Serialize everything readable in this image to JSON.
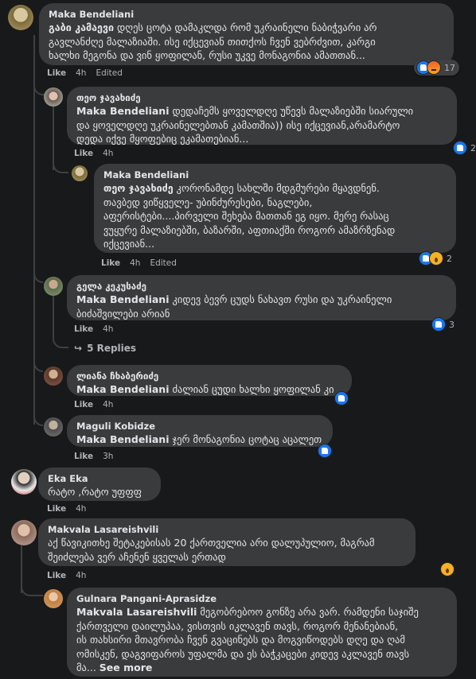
{
  "comments": [
    {
      "name": "Maka Bendeliani",
      "mention": "გაბი კამაევი",
      "text": " დღეს ცოტა დამაკლდა რომ უკრაინელი ნაბიჭვარი არ\nგავლანძღე მალაზიაში. ისე იქცევიან თითქოს ჩვენ ვებრძვით, კარგი\nხალხი მეგონა და ვინ ყოფილან, რუსი უკვე მონაგონია ამათთან...",
      "like": "Like",
      "time": "4h",
      "edited": "Edited",
      "count": "17"
    },
    {
      "name": "თეო ჯავახიძე",
      "mention": "Maka Bendeliani",
      "text": " დედაჩემს ყოველდღე უწევს მალაზიებში სიარული\nდა ყოველდღე უკრაინელებთან კამათშია)) ისე იქცევიან,არამარტო\nდედა იქვე მყოფებიც ეკამათებიან...",
      "like": "Like",
      "time": "4h",
      "count": "2"
    },
    {
      "name": "Maka Bendeliani",
      "mention": "თეო ჯავახიძე",
      "text": " კორონამდე სახლში მდგმურები მყავდნენ.\nთავბედ ვიწყველე- უბინძურესები, ნაგლები,\nაფერისტები....პირველი შეხება მათთან ეგ იყო. მერე რასაც\nვუყურე მალაზიებში, ბაზარში, აფთიაქში როგორ ამაზრზენად\nიქცევიან...",
      "like": "Like",
      "time": "4h",
      "edited": "Edited",
      "count": "2"
    },
    {
      "name": "გელა კეკუსაძე",
      "mention": "Maka Bendeliani",
      "text": " კიდევ ბევრ ცუდს ნახავთ რუსი და უკრაინელი\nბიძაშვილები არიან",
      "like": "Like",
      "time": "4h",
      "count": "3"
    },
    {
      "name": "ლიანა ჩხაბერიძე",
      "mention": "Maka Bendeliani",
      "text": " ძალიან ცუდი ხალხი ყოფილან კი",
      "like": "Like",
      "time": "4h"
    },
    {
      "name": "Maguli Kobidze",
      "mention": "Maka Bendeliani",
      "text": " ჯერ მონაგონია ცოტაც აცალეთ",
      "like": "Like",
      "time": "3h"
    },
    {
      "name": "Eka Eka",
      "mention": "",
      "text": "რატო ,რატო უფფფ",
      "like": "Like",
      "time": "4h"
    },
    {
      "name": "Makvala Lasareishvili",
      "mention": "",
      "text": "აქ წავიკითხე შეტაკებისას 20 ქართველია არი დალუპულიო, მაგრამ\nშეიძლება ვერ აჩენენ ყველას ერთად",
      "like": "Like",
      "time": "4h"
    },
    {
      "name": "Gulnara Pangani-Aprasidze",
      "mention": "Makvala Lasareishvili",
      "text": " მეგობრებოო გონზე არა ვარ. რამდენი საჯიშე\nქართველი დაილუპაა, ვისთვის იკლავენ თავს, როგორ მენანებიან,\nის თახსირი მთავრობა ჩვენ გვაცინებს და მოგვიწოდებს დღე და ღამ\nომისკენ, დაგვიფაროს უფალმა და ეს ბაჭკაცები კიდევ აკლავენ თავს\nმა...",
      "see_more": "See more"
    }
  ],
  "view_replies": "5 Replies",
  "colors": {
    "bg": "#18191a",
    "bubble": "#3a3b3c",
    "meta": "#b0b3b8",
    "like_blue": "#1877f2"
  }
}
